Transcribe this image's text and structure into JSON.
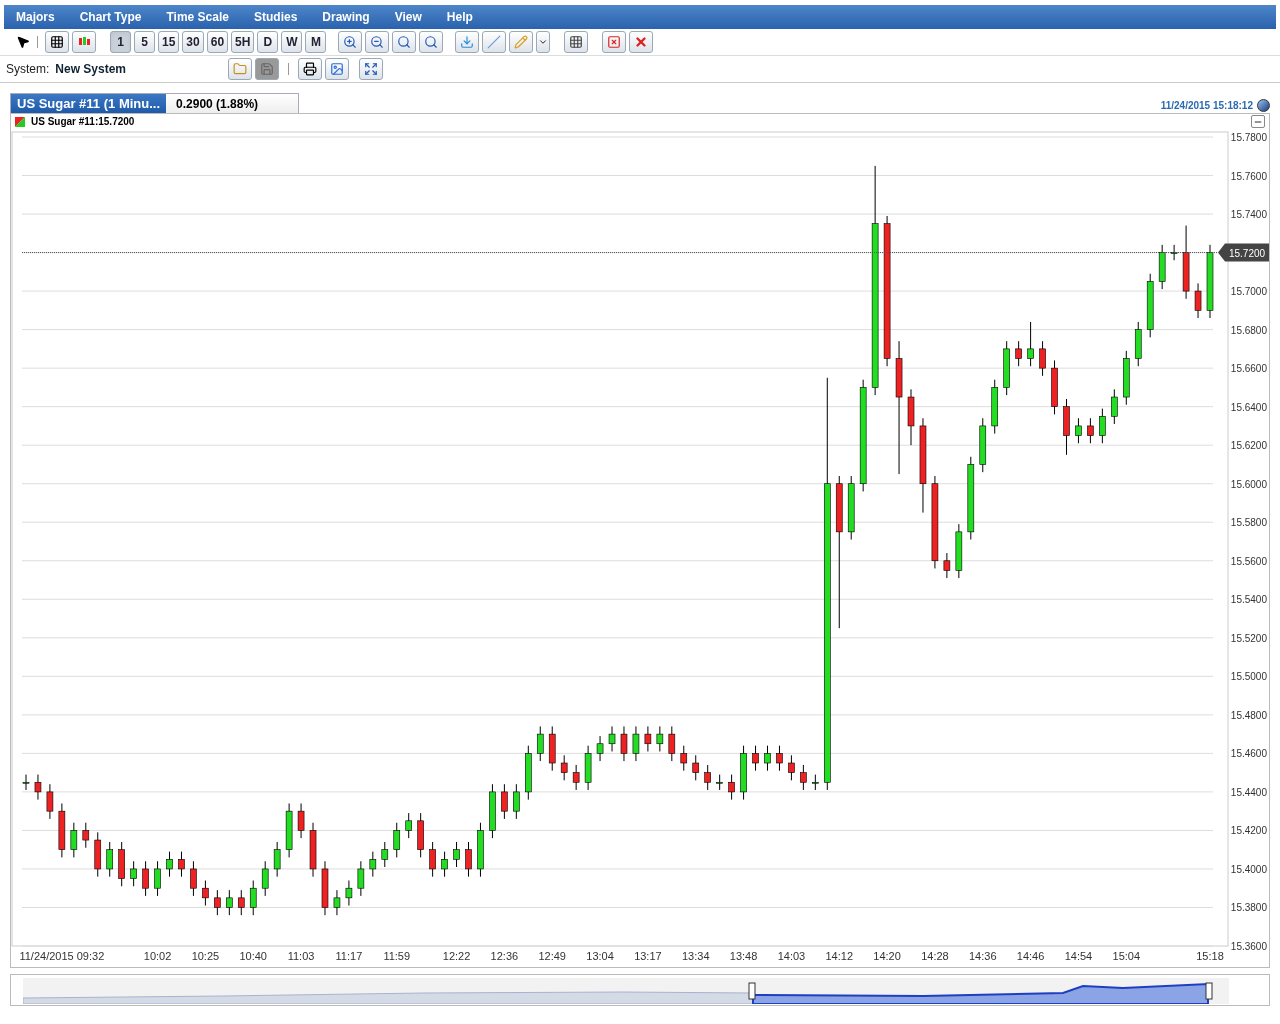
{
  "menu": [
    "Majors",
    "Chart Type",
    "Time Scale",
    "Studies",
    "Drawing",
    "View",
    "Help"
  ],
  "timescales": [
    {
      "label": "1",
      "selected": true
    },
    {
      "label": "5",
      "selected": false
    },
    {
      "label": "15",
      "selected": false
    },
    {
      "label": "30",
      "selected": false
    },
    {
      "label": "60",
      "selected": false
    },
    {
      "label": "5H",
      "selected": false
    },
    {
      "label": "D",
      "selected": false
    },
    {
      "label": "W",
      "selected": false
    },
    {
      "label": "M",
      "selected": false
    }
  ],
  "system": {
    "label": "System:",
    "value": "New System"
  },
  "tab": {
    "title": "US Sugar #11 (1 Minu...",
    "change": "0.2900 (1.88%)"
  },
  "timestamp": "11/24/2015 15:18:12",
  "chart": {
    "legend": "US Sugar #11:15.7200",
    "chart_data": {
      "type": "candlestick",
      "grid": true,
      "ylim": [
        15.36,
        15.78
      ],
      "yticks": [
        {
          "value": 15.36,
          "label": "15.3600"
        },
        {
          "value": 15.38,
          "label": "15.3800"
        },
        {
          "value": 15.4,
          "label": "15.4000"
        },
        {
          "value": 15.42,
          "label": "15.4200"
        },
        {
          "value": 15.44,
          "label": "15.4400"
        },
        {
          "value": 15.46,
          "label": "15.4600"
        },
        {
          "value": 15.48,
          "label": "15.4800"
        },
        {
          "value": 15.5,
          "label": "15.5000"
        },
        {
          "value": 15.52,
          "label": "15.5200"
        },
        {
          "value": 15.54,
          "label": "15.5400"
        },
        {
          "value": 15.56,
          "label": "15.5600"
        },
        {
          "value": 15.58,
          "label": "15.5800"
        },
        {
          "value": 15.6,
          "label": "15.6000"
        },
        {
          "value": 15.62,
          "label": "15.6200"
        },
        {
          "value": 15.64,
          "label": "15.6400"
        },
        {
          "value": 15.66,
          "label": "15.6600"
        },
        {
          "value": 15.68,
          "label": "15.6800"
        },
        {
          "value": 15.7,
          "label": "15.7000"
        },
        {
          "value": 15.72,
          "label": "15.7200"
        },
        {
          "value": 15.74,
          "label": "15.7400"
        },
        {
          "value": 15.76,
          "label": "15.7600"
        },
        {
          "value": 15.78,
          "label": "15.7800"
        }
      ],
      "categories": [
        null,
        null,
        null,
        "11/24/2015 09:32",
        null,
        null,
        null,
        null,
        null,
        null,
        null,
        "10:02",
        null,
        null,
        null,
        "10:25",
        null,
        null,
        null,
        "10:40",
        null,
        null,
        null,
        "11:03",
        null,
        null,
        null,
        "11:17",
        null,
        null,
        null,
        "11:59",
        null,
        null,
        null,
        null,
        "12:22",
        null,
        null,
        null,
        "12:36",
        null,
        null,
        null,
        "12:49",
        null,
        null,
        null,
        "13:04",
        null,
        null,
        null,
        "13:17",
        null,
        null,
        null,
        "13:34",
        null,
        null,
        null,
        "13:48",
        null,
        null,
        null,
        "14:03",
        null,
        null,
        null,
        "14:12",
        null,
        null,
        null,
        "14:20",
        null,
        null,
        null,
        "14:28",
        null,
        null,
        null,
        "14:36",
        null,
        null,
        null,
        "14:46",
        null,
        null,
        null,
        "14:54",
        null,
        null,
        null,
        "15:04",
        null,
        null,
        null,
        null,
        null,
        null,
        "15:18"
      ],
      "ref_lines": [
        {
          "axis": "y",
          "value": 15.72,
          "label": "15.7200"
        }
      ],
      "ohlc": [
        [
          15.445,
          15.449,
          15.441,
          15.445
        ],
        [
          15.445,
          15.449,
          15.436,
          15.44
        ],
        [
          15.44,
          15.444,
          15.426,
          15.43
        ],
        [
          15.43,
          15.434,
          15.406,
          15.41
        ],
        [
          15.41,
          15.424,
          15.406,
          15.42
        ],
        [
          15.42,
          15.424,
          15.411,
          15.415
        ],
        [
          15.415,
          15.419,
          15.396,
          15.4
        ],
        [
          15.4,
          15.414,
          15.396,
          15.41
        ],
        [
          15.41,
          15.414,
          15.391,
          15.395
        ],
        [
          15.395,
          15.404,
          15.391,
          15.4
        ],
        [
          15.4,
          15.404,
          15.386,
          15.39
        ],
        [
          15.39,
          15.404,
          15.386,
          15.4
        ],
        [
          15.4,
          15.409,
          15.396,
          15.405
        ],
        [
          15.405,
          15.409,
          15.396,
          15.4
        ],
        [
          15.4,
          15.404,
          15.386,
          15.39
        ],
        [
          15.39,
          15.394,
          15.381,
          15.385
        ],
        [
          15.385,
          15.389,
          15.376,
          15.38
        ],
        [
          15.38,
          15.389,
          15.376,
          15.385
        ],
        [
          15.385,
          15.389,
          15.376,
          15.38
        ],
        [
          15.38,
          15.394,
          15.376,
          15.39
        ],
        [
          15.39,
          15.404,
          15.386,
          15.4
        ],
        [
          15.4,
          15.414,
          15.396,
          15.41
        ],
        [
          15.41,
          15.434,
          15.406,
          15.43
        ],
        [
          15.43,
          15.434,
          15.416,
          15.42
        ],
        [
          15.42,
          15.424,
          15.396,
          15.4
        ],
        [
          15.4,
          15.404,
          15.376,
          15.38
        ],
        [
          15.38,
          15.389,
          15.376,
          15.385
        ],
        [
          15.385,
          15.394,
          15.381,
          15.39
        ],
        [
          15.39,
          15.404,
          15.386,
          15.4
        ],
        [
          15.4,
          15.409,
          15.396,
          15.405
        ],
        [
          15.405,
          15.414,
          15.401,
          15.41
        ],
        [
          15.41,
          15.424,
          15.406,
          15.42
        ],
        [
          15.42,
          15.429,
          15.416,
          15.425
        ],
        [
          15.425,
          15.429,
          15.406,
          15.41
        ],
        [
          15.41,
          15.414,
          15.396,
          15.4
        ],
        [
          15.4,
          15.409,
          15.396,
          15.405
        ],
        [
          15.405,
          15.414,
          15.401,
          15.41
        ],
        [
          15.41,
          15.414,
          15.396,
          15.4
        ],
        [
          15.4,
          15.424,
          15.396,
          15.42
        ],
        [
          15.42,
          15.444,
          15.416,
          15.44
        ],
        [
          15.44,
          15.444,
          15.426,
          15.43
        ],
        [
          15.43,
          15.444,
          15.426,
          15.44
        ],
        [
          15.44,
          15.464,
          15.436,
          15.46
        ],
        [
          15.46,
          15.474,
          15.456,
          15.47
        ],
        [
          15.47,
          15.474,
          15.451,
          15.455
        ],
        [
          15.455,
          15.459,
          15.446,
          15.45
        ],
        [
          15.45,
          15.454,
          15.441,
          15.445
        ],
        [
          15.445,
          15.464,
          15.441,
          15.46
        ],
        [
          15.46,
          15.469,
          15.456,
          15.465
        ],
        [
          15.465,
          15.474,
          15.461,
          15.47
        ],
        [
          15.47,
          15.474,
          15.456,
          15.46
        ],
        [
          15.46,
          15.474,
          15.456,
          15.47
        ],
        [
          15.47,
          15.474,
          15.461,
          15.465
        ],
        [
          15.465,
          15.474,
          15.461,
          15.47
        ],
        [
          15.47,
          15.474,
          15.456,
          15.46
        ],
        [
          15.46,
          15.464,
          15.451,
          15.455
        ],
        [
          15.455,
          15.459,
          15.446,
          15.45
        ],
        [
          15.45,
          15.454,
          15.441,
          15.445
        ],
        [
          15.445,
          15.449,
          15.441,
          15.445
        ],
        [
          15.445,
          15.449,
          15.436,
          15.44
        ],
        [
          15.44,
          15.464,
          15.436,
          15.46
        ],
        [
          15.46,
          15.464,
          15.451,
          15.455
        ],
        [
          15.455,
          15.464,
          15.451,
          15.46
        ],
        [
          15.46,
          15.464,
          15.451,
          15.455
        ],
        [
          15.455,
          15.459,
          15.446,
          15.45
        ],
        [
          15.45,
          15.454,
          15.441,
          15.445
        ],
        [
          15.445,
          15.449,
          15.441,
          15.445
        ],
        [
          15.445,
          15.655,
          15.441,
          15.6
        ],
        [
          15.6,
          15.604,
          15.525,
          15.575
        ],
        [
          15.575,
          15.604,
          15.571,
          15.6
        ],
        [
          15.6,
          15.654,
          15.596,
          15.65
        ],
        [
          15.65,
          15.765,
          15.646,
          15.735
        ],
        [
          15.735,
          15.739,
          15.661,
          15.665
        ],
        [
          15.665,
          15.674,
          15.605,
          15.645
        ],
        [
          15.645,
          15.649,
          15.62,
          15.63
        ],
        [
          15.63,
          15.634,
          15.585,
          15.6
        ],
        [
          15.6,
          15.604,
          15.556,
          15.56
        ],
        [
          15.56,
          15.564,
          15.551,
          15.555
        ],
        [
          15.555,
          15.579,
          15.551,
          15.575
        ],
        [
          15.575,
          15.614,
          15.571,
          15.61
        ],
        [
          15.61,
          15.634,
          15.606,
          15.63
        ],
        [
          15.63,
          15.654,
          15.626,
          15.65
        ],
        [
          15.65,
          15.674,
          15.646,
          15.67
        ],
        [
          15.67,
          15.674,
          15.661,
          15.665
        ],
        [
          15.665,
          15.684,
          15.661,
          15.67
        ],
        [
          15.67,
          15.674,
          15.656,
          15.66
        ],
        [
          15.66,
          15.664,
          15.636,
          15.64
        ],
        [
          15.64,
          15.644,
          15.615,
          15.625
        ],
        [
          15.625,
          15.634,
          15.621,
          15.63
        ],
        [
          15.63,
          15.634,
          15.621,
          15.625
        ],
        [
          15.625,
          15.639,
          15.621,
          15.635
        ],
        [
          15.635,
          15.649,
          15.631,
          15.645
        ],
        [
          15.645,
          15.669,
          15.641,
          15.665
        ],
        [
          15.665,
          15.684,
          15.661,
          15.68
        ],
        [
          15.68,
          15.709,
          15.676,
          15.705
        ],
        [
          15.705,
          15.724,
          15.701,
          15.72
        ],
        [
          15.72,
          15.724,
          15.716,
          15.72
        ],
        [
          15.72,
          15.734,
          15.696,
          15.7
        ],
        [
          15.7,
          15.704,
          15.686,
          15.69
        ],
        [
          15.69,
          15.724,
          15.686,
          15.72
        ]
      ]
    }
  }
}
